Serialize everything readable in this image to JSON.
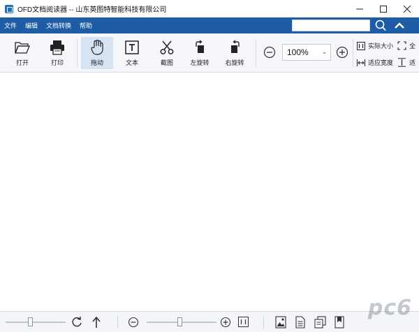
{
  "window": {
    "title": "OFD文档阅读器 -- 山东英图特智能科技有限公司",
    "controls": [
      "minimize",
      "maximize",
      "close"
    ]
  },
  "menu": {
    "items": [
      {
        "label": "文件"
      },
      {
        "label": "编辑"
      },
      {
        "label": "文档转换"
      },
      {
        "label": "帮助"
      }
    ],
    "search": {
      "value": "",
      "placeholder": ""
    }
  },
  "toolbar": {
    "open": "打开",
    "print": "打印",
    "drag": "拖动",
    "text": "文本",
    "screenshot": "截图",
    "rotate_left": "左旋转",
    "rotate_right": "右旋转",
    "zoom_value": "100%",
    "actual_size": "实际大小",
    "fit_width": "适应宽度",
    "full": "全",
    "fit": "适",
    "active_tool": "drag"
  },
  "colors": {
    "menu_bg": "#1e5ca5",
    "toolbar_bg": "#f5f7fa",
    "active_tool_bg": "#d5e3f3"
  },
  "watermark": "pc6"
}
